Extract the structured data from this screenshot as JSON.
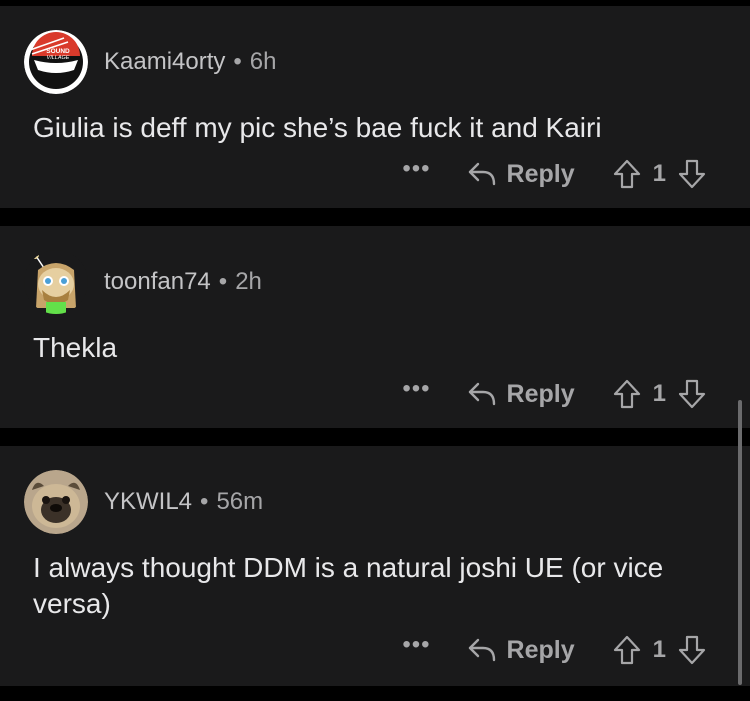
{
  "comments": [
    {
      "username": "Kaami4orty",
      "time": "6h",
      "text": "Giulia is deff my pic she’s bae fuck it and Kairi",
      "avatar_text": "SOUND VILLAGE",
      "more_label": "•••",
      "reply_label": "Reply",
      "votes": "1"
    },
    {
      "username": "toonfan74",
      "time": "2h",
      "text": "Thekla",
      "more_label": "•••",
      "reply_label": "Reply",
      "votes": "1"
    },
    {
      "username": "YKWIL4",
      "time": "56m",
      "text": "I always thought DDM is a natural joshi UE (or vice versa)",
      "more_label": "•••",
      "reply_label": "Reply",
      "votes": "1"
    }
  ],
  "separator": "•",
  "icons": {
    "reply": "reply-arrow-icon",
    "upvote": "upvote-arrow-icon",
    "downvote": "downvote-arrow-icon"
  },
  "colors": {
    "background": "#000000",
    "card": "#1a1a1b",
    "text_primary": "#e8e8ea",
    "text_secondary": "#a6a6a8",
    "avatar_red": "#d93a2b"
  }
}
